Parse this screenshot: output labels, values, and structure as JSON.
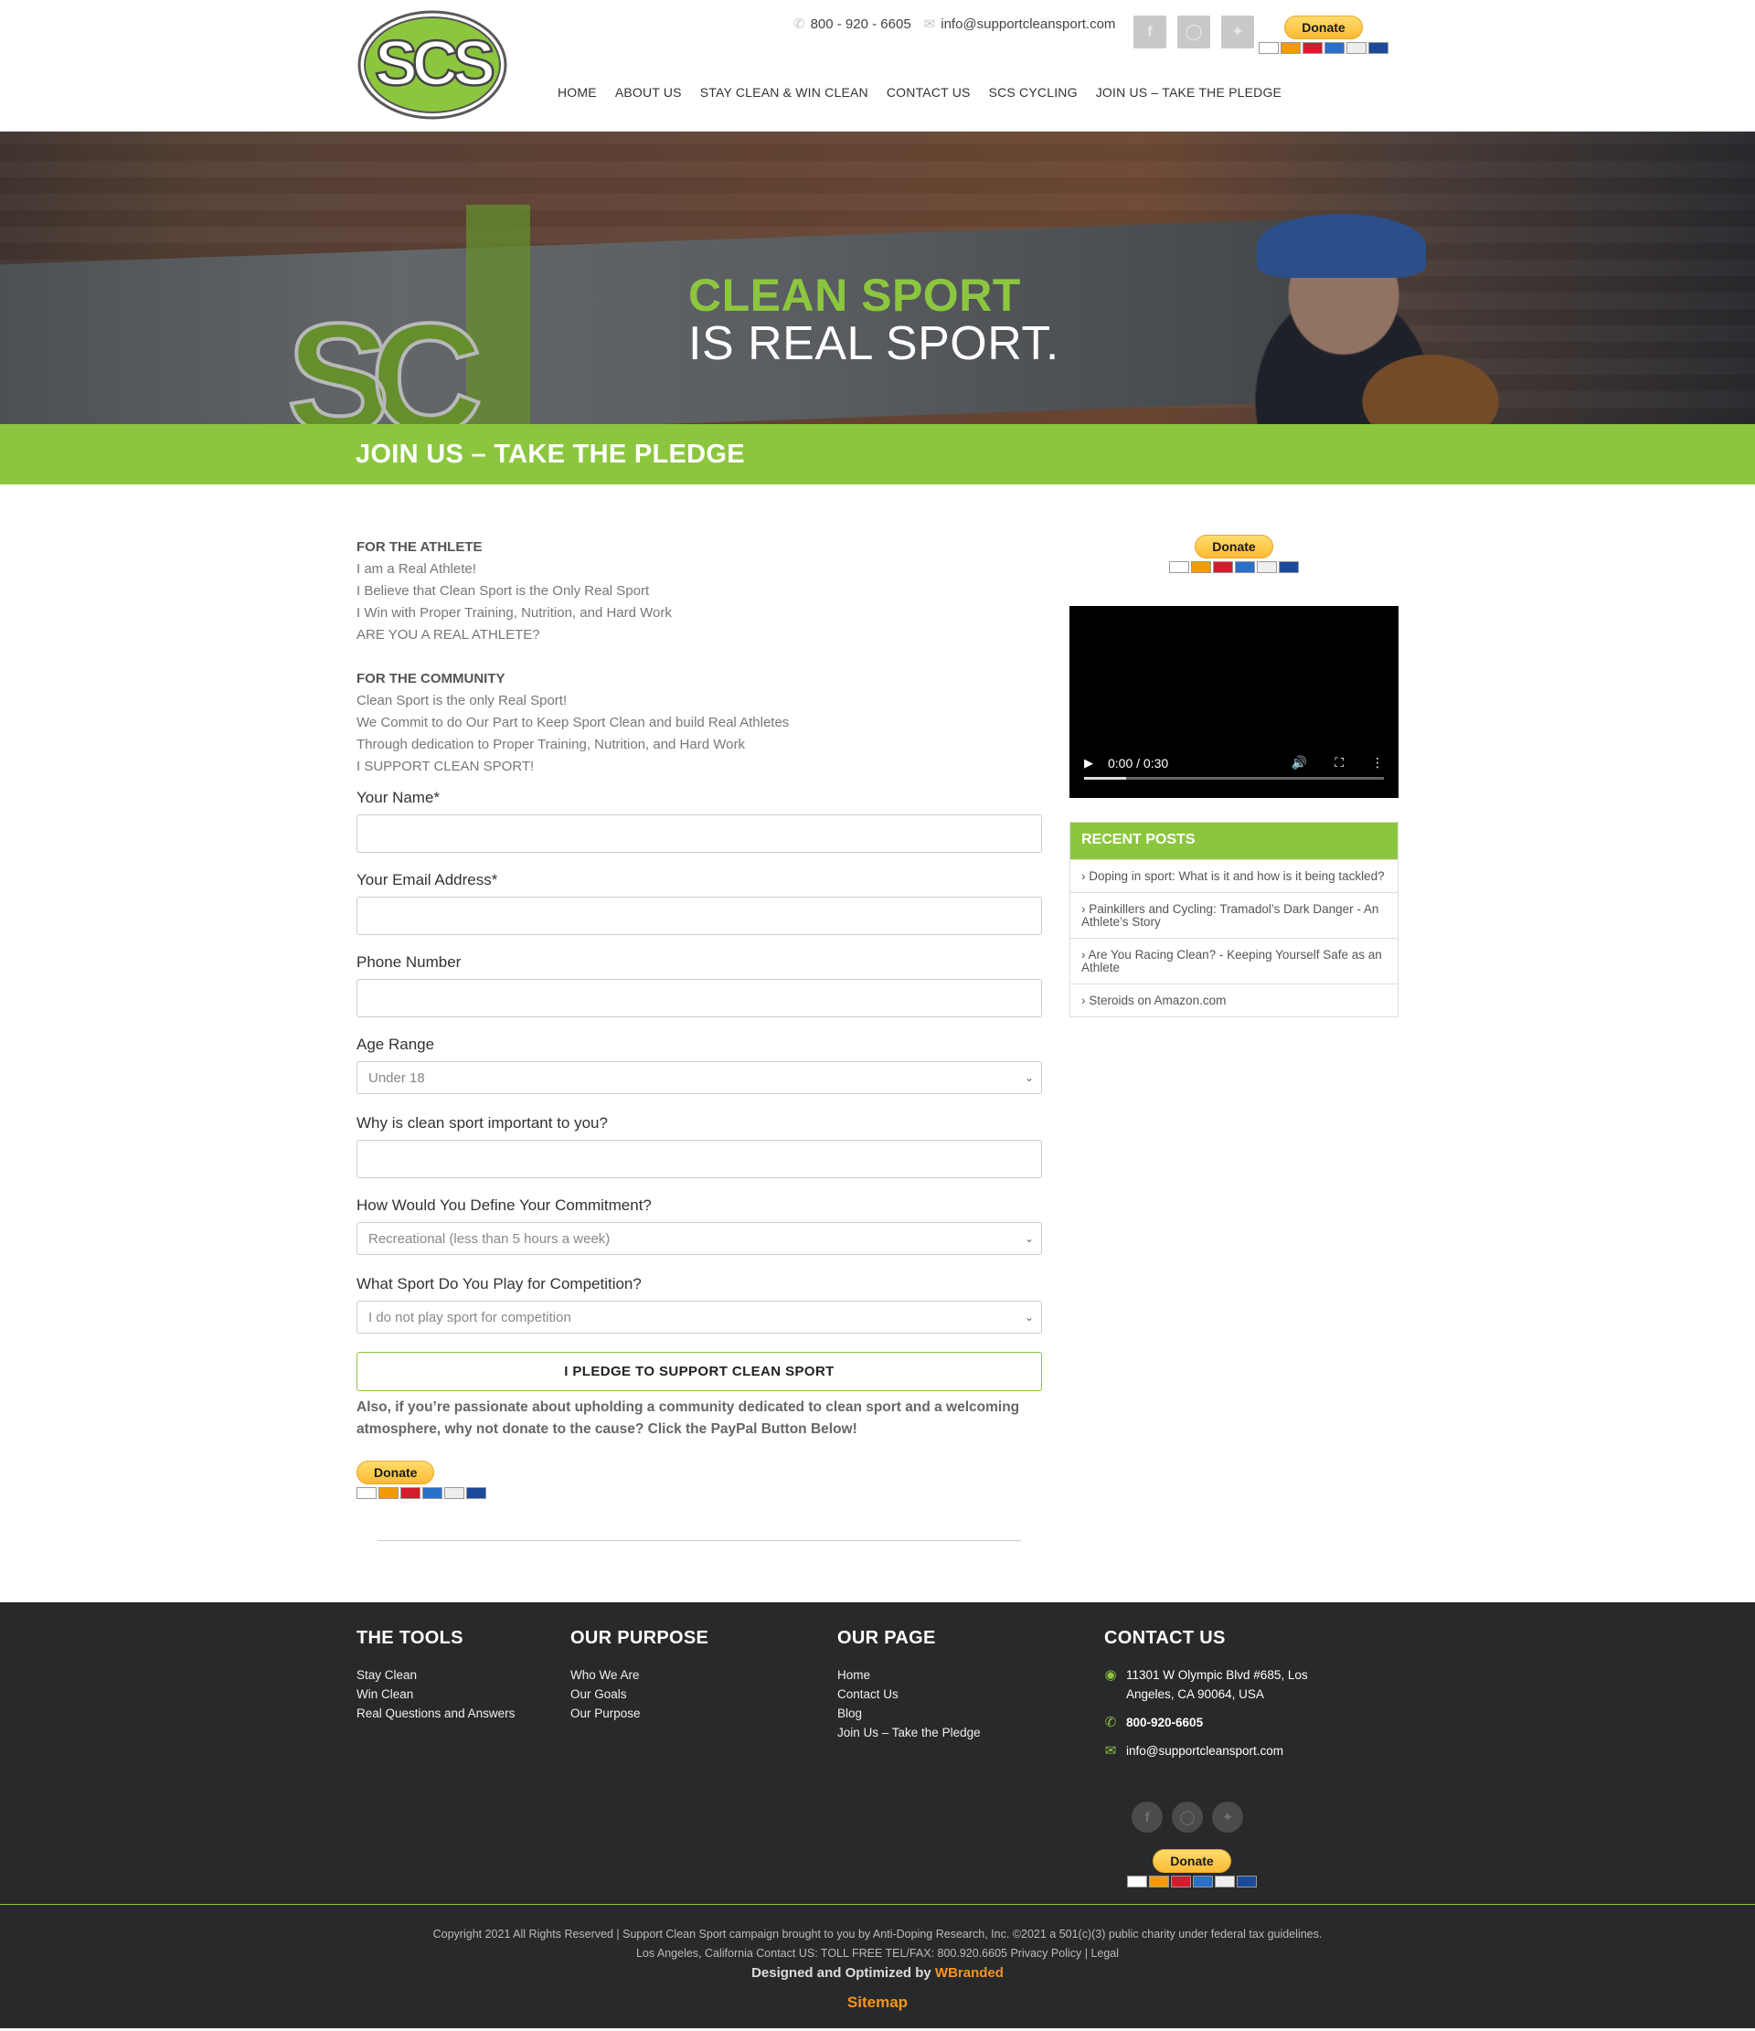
{
  "header": {
    "phone": "800 - 920 - 6605",
    "email": "info@supportcleansport.com",
    "donate_label": "Donate",
    "logo_text": "SCS",
    "nav": [
      "HOME",
      "ABOUT US",
      "STAY CLEAN & WIN CLEAN",
      "CONTACT US",
      "SCS CYCLING",
      "JOIN US – TAKE THE PLEDGE"
    ],
    "social": [
      "facebook-icon",
      "instagram-icon",
      "twitter-icon"
    ]
  },
  "hero": {
    "line1": "CLEAN SPORT",
    "line2": "IS REAL SPORT."
  },
  "page_title": "JOIN US – TAKE THE PLEDGE",
  "athlete": {
    "heading": "FOR THE ATHLETE",
    "lines": [
      "I am a Real Athlete!",
      "I Believe that Clean Sport is the Only Real Sport",
      "I Win with Proper Training, Nutrition, and Hard Work",
      "ARE YOU A REAL ATHLETE?"
    ]
  },
  "community": {
    "heading": "FOR THE COMMUNITY",
    "lines": [
      "Clean Sport is the only Real Sport!",
      "We Commit to do Our Part to Keep Sport Clean and build Real Athletes",
      "Through dedication to Proper Training, Nutrition, and Hard Work",
      "I SUPPORT CLEAN SPORT!"
    ]
  },
  "form": {
    "name_label": "Your Name*",
    "email_label": "Your Email Address*",
    "phone_label": "Phone Number",
    "age_label": "Age Range",
    "age_value": "Under 18",
    "why_label": "Why is clean sport important to you?",
    "commit_label": "How Would You Define Your Commitment?",
    "commit_value": "Recreational (less than 5 hours a week)",
    "sport_label": "What Sport Do You Play for Competition?",
    "sport_value": "I do not play sport for competition",
    "submit_label": "I PLEDGE TO SUPPORT CLEAN SPORT"
  },
  "donate_note": "Also, if you’re passionate about upholding a community dedicated to clean sport and a welcoming atmosphere, why not donate to the cause? Click the PayPal Button Below!",
  "video": {
    "time": "0:00 / 0:30",
    "progress": 0.14
  },
  "recent_posts": {
    "heading": "RECENT POSTS",
    "items": [
      "Doping in sport: What is it and how is it being tackled?",
      "Painkillers and Cycling: Tramadol’s Dark Danger - An Athlete’s Story",
      "Are You Racing Clean? - Keeping Yourself Safe as an Athlete",
      "Steroids on Amazon.com"
    ]
  },
  "footer": {
    "tools": {
      "heading": "THE TOOLS",
      "links": [
        "Stay Clean",
        "Win Clean",
        "Real Questions and Answers"
      ]
    },
    "purpose": {
      "heading": "OUR PURPOSE",
      "links": [
        "Who We Are",
        "Our Goals",
        "Our Purpose"
      ]
    },
    "page": {
      "heading": "OUR PAGE",
      "links": [
        "Home",
        "Contact Us",
        "Blog",
        "Join Us – Take the Pledge"
      ]
    },
    "contact": {
      "heading": "CONTACT US",
      "address_line1": "11301 W Olympic Blvd #685, Los",
      "address_line2": "Angeles, CA 90064, USA",
      "phone": "800-920-6605",
      "email": "info@supportcleansport.com"
    },
    "copyright1": "Copyright 2021 All Rights Reserved | Support Clean Sport campaign brought to you by Anti-Doping Research, Inc. ©2021 a 501(c)(3) public charity under federal tax guidelines.",
    "copyright2": "Los Angeles, California Contact US: TOLL FREE TEL/FAX: 800.920.6605 Privacy Policy | Legal",
    "designed_prefix": "Designed and Optimized by ",
    "designed_brand": "WBranded",
    "sitemap": "Sitemap"
  },
  "colors": {
    "accent_green": "#8cc63f",
    "footer_bg": "#28292b",
    "brand_orange": "#f7941d"
  }
}
